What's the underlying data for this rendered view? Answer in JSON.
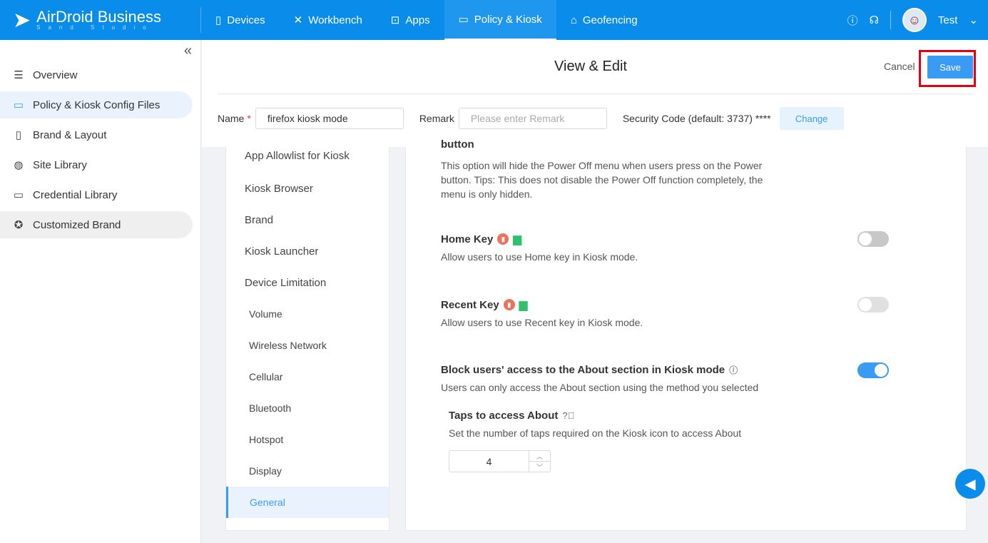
{
  "brand": {
    "name": "AirDroid Business",
    "sub": "Sand Studio"
  },
  "nav": [
    {
      "label": "Devices",
      "icon": "phone-icon"
    },
    {
      "label": "Workbench",
      "icon": "tools-icon"
    },
    {
      "label": "Apps",
      "icon": "bag-icon"
    },
    {
      "label": "Policy & Kiosk",
      "icon": "folder-icon",
      "active": true
    },
    {
      "label": "Geofencing",
      "icon": "map-icon"
    }
  ],
  "user": {
    "name": "Test"
  },
  "sidebar": {
    "items": [
      {
        "label": "Overview"
      },
      {
        "label": "Policy & Kiosk Config Files"
      },
      {
        "label": "Brand & Layout"
      },
      {
        "label": "Site Library"
      },
      {
        "label": "Credential Library"
      },
      {
        "label": "Customized Brand"
      }
    ]
  },
  "header": {
    "title": "View & Edit",
    "cancel": "Cancel",
    "save": "Save",
    "name_label": "Name",
    "name_value": "firefox kiosk mode",
    "remark_label": "Remark",
    "remark_placeholder": "Please enter Remark",
    "security": "Security Code (default: 3737) ****",
    "change": "Change"
  },
  "menu": [
    "App Allowlist for Kiosk",
    "Kiosk Browser",
    "Brand",
    "Kiosk Launcher",
    "Device Limitation",
    "Volume",
    "Wireless Network",
    "Cellular",
    "Bluetooth",
    "Hotspot",
    "Display",
    "General"
  ],
  "content": {
    "cut_title": "button",
    "power_desc": "This option will hide the Power Off menu when users press on the Power button. Tips: This does not disable the Power Off function completely, the menu is only hidden.",
    "home_title": "Home Key",
    "home_desc": "Allow users to use Home key in Kiosk mode.",
    "home_on": false,
    "recent_title": "Recent Key",
    "recent_desc": "Allow users to use Recent key in Kiosk mode.",
    "recent_on": false,
    "about_title": "Block users' access to the About section in Kiosk mode",
    "about_desc": "Users can only access the About section using the method you selected",
    "about_on": true,
    "taps_title": "Taps to access About",
    "taps_desc": "Set the number of taps required on the Kiosk icon to access About",
    "taps_value": "4"
  },
  "colors": {
    "primary": "#0a8ceb",
    "accent": "#3a9bf5",
    "highlight": "#e60012"
  }
}
